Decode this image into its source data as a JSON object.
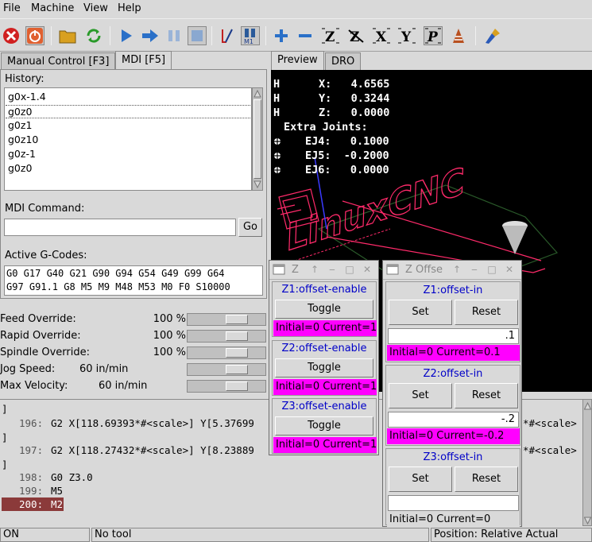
{
  "menubar": {
    "items": [
      "File",
      "Machine",
      "View",
      "Help"
    ]
  },
  "toolbar": {
    "buttons": [
      "estop-icon",
      "power-icon",
      "open-file-icon",
      "reload-icon",
      "run-icon",
      "step-icon",
      "pause-icon",
      "stop-icon",
      "block-delete-icon",
      "optional-stop-icon",
      "zoom-in-icon",
      "zoom-out-icon",
      "view-z-icon",
      "view-z2-icon",
      "view-x-icon",
      "view-y-icon",
      "view-p-icon",
      "rotate-view-icon",
      "clear-plot-icon"
    ]
  },
  "left_tabs": [
    {
      "label": "Manual Control [F3]"
    },
    {
      "label": "MDI [F5]"
    }
  ],
  "mdi": {
    "history_label": "History:",
    "history": [
      "g0x-1.4",
      "g0z0",
      "g0z1",
      "g0z10",
      "g0z-1",
      "g0z0"
    ],
    "command_label": "MDI Command:",
    "command_value": "",
    "go_label": "Go",
    "active_label": "Active G-Codes:",
    "active_line1": "G0 G17 G40 G21 G90 G94 G54 G49 G99 G64",
    "active_line2": "G97 G91.1 G8 M5 M9 M48 M53 M0 F0 S10000"
  },
  "overrides": {
    "feed": {
      "label": "Feed Override:",
      "value": "100 %",
      "fraction": 0.7
    },
    "rapid": {
      "label": "Rapid Override:",
      "value": "100 %",
      "fraction": 0.7
    },
    "spindle": {
      "label": "Spindle Override:",
      "value": "100 %",
      "fraction": 0.7
    },
    "jog": {
      "label": "Jog Speed:",
      "value": "60 in/min",
      "fraction": 0.7
    },
    "maxvel": {
      "label": "Max Velocity:",
      "value": "60 in/min",
      "fraction": 0.7
    }
  },
  "right_tabs": [
    {
      "label": "Preview"
    },
    {
      "label": "DRO"
    }
  ],
  "dro": {
    "x": {
      "flag": "H",
      "text": "X:   4.6565"
    },
    "y": {
      "flag": "H",
      "text": "Y:   0.3244"
    },
    "z": {
      "flag": "H",
      "text": "Z:   0.0000"
    },
    "extra": "Extra Joints:",
    "ej4": "EJ4:   0.1000",
    "ej5": "EJ5:  -0.2000",
    "ej6": "EJ6:   0.0000"
  },
  "preview_text": "LinuxCNC",
  "gcode": {
    "l0": "]",
    "l1n": "196:",
    "l1": "G2 X[118.69393*#<scale>] Y[5.37699",
    "l1r": "*#<scale>",
    "l2": "]",
    "l3n": "197:",
    "l3": "G2 X[118.27432*#<scale>] Y[8.23889",
    "l3r": "*#<scale>",
    "l4": "]",
    "l5n": "198:",
    "l5": "G0 Z3.0",
    "l6n": "199:",
    "l6": "M5",
    "l7n": "200:",
    "l7": "M2"
  },
  "win_enable": {
    "title": "Z",
    "panels": [
      {
        "label": "Z1:offset-enable",
        "button": "Toggle",
        "status": "Initial=0 Current=1"
      },
      {
        "label": "Z2:offset-enable",
        "button": "Toggle",
        "status": "Initial=0 Current=1"
      },
      {
        "label": "Z3:offset-enable",
        "button": "Toggle",
        "status": "Initial=0 Current=1"
      }
    ]
  },
  "win_offsets": {
    "title": "Z Offse",
    "panels": [
      {
        "label": "Z1:offset-in",
        "set": "Set",
        "reset": "Reset",
        "entry": ".1",
        "status": "Initial=0 Current=0.1",
        "status_color": "#ff00ff"
      },
      {
        "label": "Z2:offset-in",
        "set": "Set",
        "reset": "Reset",
        "entry": "-.2",
        "status": "Initial=0 Current=-0.2",
        "status_color": "#ff00ff"
      },
      {
        "label": "Z3:offset-in",
        "set": "Set",
        "reset": "Reset",
        "entry": "",
        "status": "Initial=0 Current=0",
        "status_color": "#d9d9d9"
      }
    ]
  },
  "statusbar": {
    "state": "ON",
    "tool": "No tool",
    "position": "Position: Relative Actual"
  },
  "colors": {
    "magenta": "#ff00ff",
    "hal_label": "#0000c8",
    "current_line": "#8b3a3a",
    "preview_bg": "#000000"
  }
}
